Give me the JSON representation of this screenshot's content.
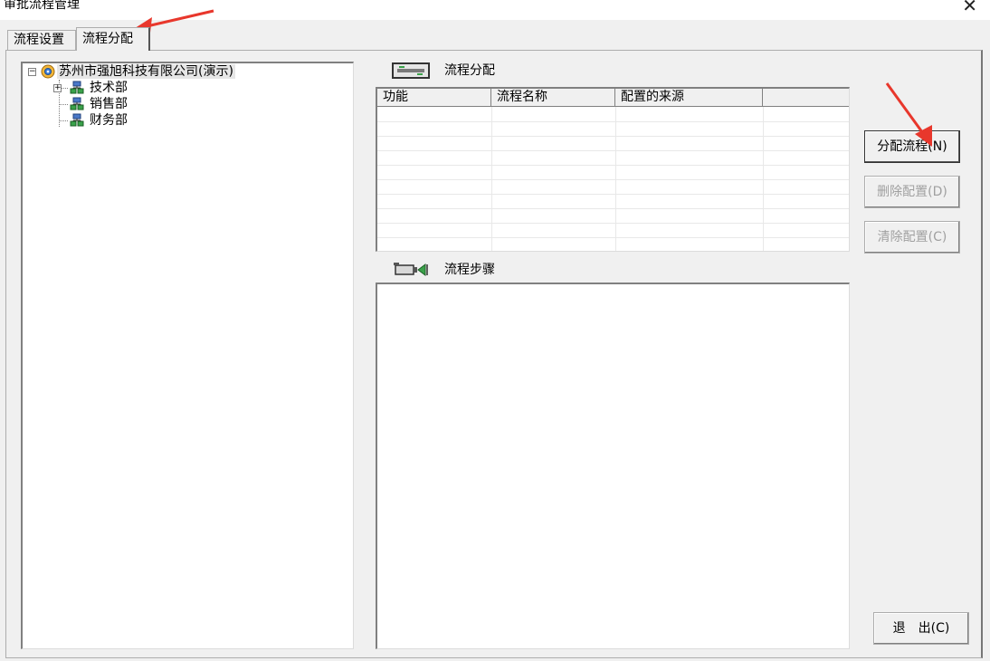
{
  "window": {
    "title": "审批流程管理",
    "close_glyph": "✕"
  },
  "tabs": [
    {
      "label": "流程设置",
      "selected": false
    },
    {
      "label": "流程分配",
      "selected": true
    }
  ],
  "tree": {
    "expander_collapse": "−",
    "expander_expand": "+",
    "root": {
      "label": "苏州市强旭科技有限公司(演示)",
      "icon": "organization-icon"
    },
    "children": [
      {
        "label": "技术部",
        "icon": "department-icon",
        "expandable": true
      },
      {
        "label": "销售部",
        "icon": "department-icon",
        "expandable": false
      },
      {
        "label": "财务部",
        "icon": "department-icon",
        "expandable": false
      }
    ]
  },
  "assignment": {
    "heading": "流程分配",
    "icon": "assignment-icon",
    "columns": [
      "功能",
      "流程名称",
      "配置的来源",
      ""
    ],
    "rows": []
  },
  "steps": {
    "heading": "流程步骤",
    "icon": "camera-icon"
  },
  "buttons": {
    "assign": "分配流程(N)",
    "delete": "删除配置(D)",
    "clear": "清除配置(C)",
    "exit": "退　出(C)"
  },
  "colors": {
    "dialog_bg": "#f0f0f0",
    "annotation_arrow": "#e8372c"
  }
}
